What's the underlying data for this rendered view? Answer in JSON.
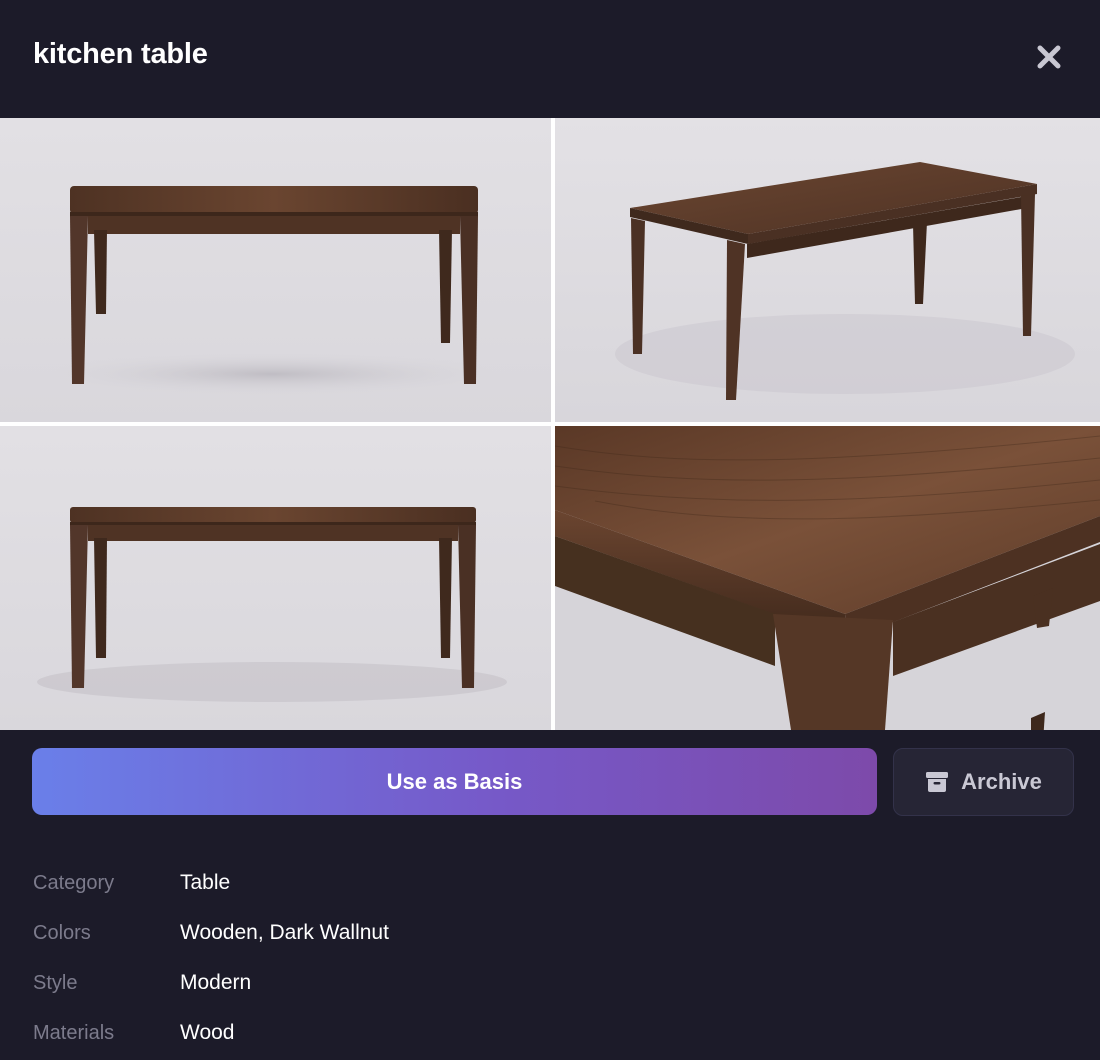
{
  "modal": {
    "title": "kitchen table",
    "close_icon": "close-icon"
  },
  "gallery": {
    "images": [
      {
        "view": "front view",
        "icon": "table-photo"
      },
      {
        "view": "three-quarter view",
        "icon": "table-photo"
      },
      {
        "view": "front view",
        "icon": "table-photo"
      },
      {
        "view": "corner close-up",
        "icon": "table-photo"
      }
    ]
  },
  "actions": {
    "use_as_basis_label": "Use as Basis",
    "archive_label": "Archive",
    "archive_icon": "archive-box-icon",
    "gradient_start": "#6a7fe9",
    "gradient_end": "#7d4aaa"
  },
  "details": [
    {
      "label": "Category",
      "value": "Table"
    },
    {
      "label": "Colors",
      "value": "Wooden, Dark Wallnut"
    },
    {
      "label": "Style",
      "value": "Modern"
    },
    {
      "label": "Materials",
      "value": "Wood"
    }
  ],
  "colors": {
    "background": "#1c1b29",
    "wood": "#5a3a28",
    "photo_backdrop": "#e4e2e6"
  }
}
